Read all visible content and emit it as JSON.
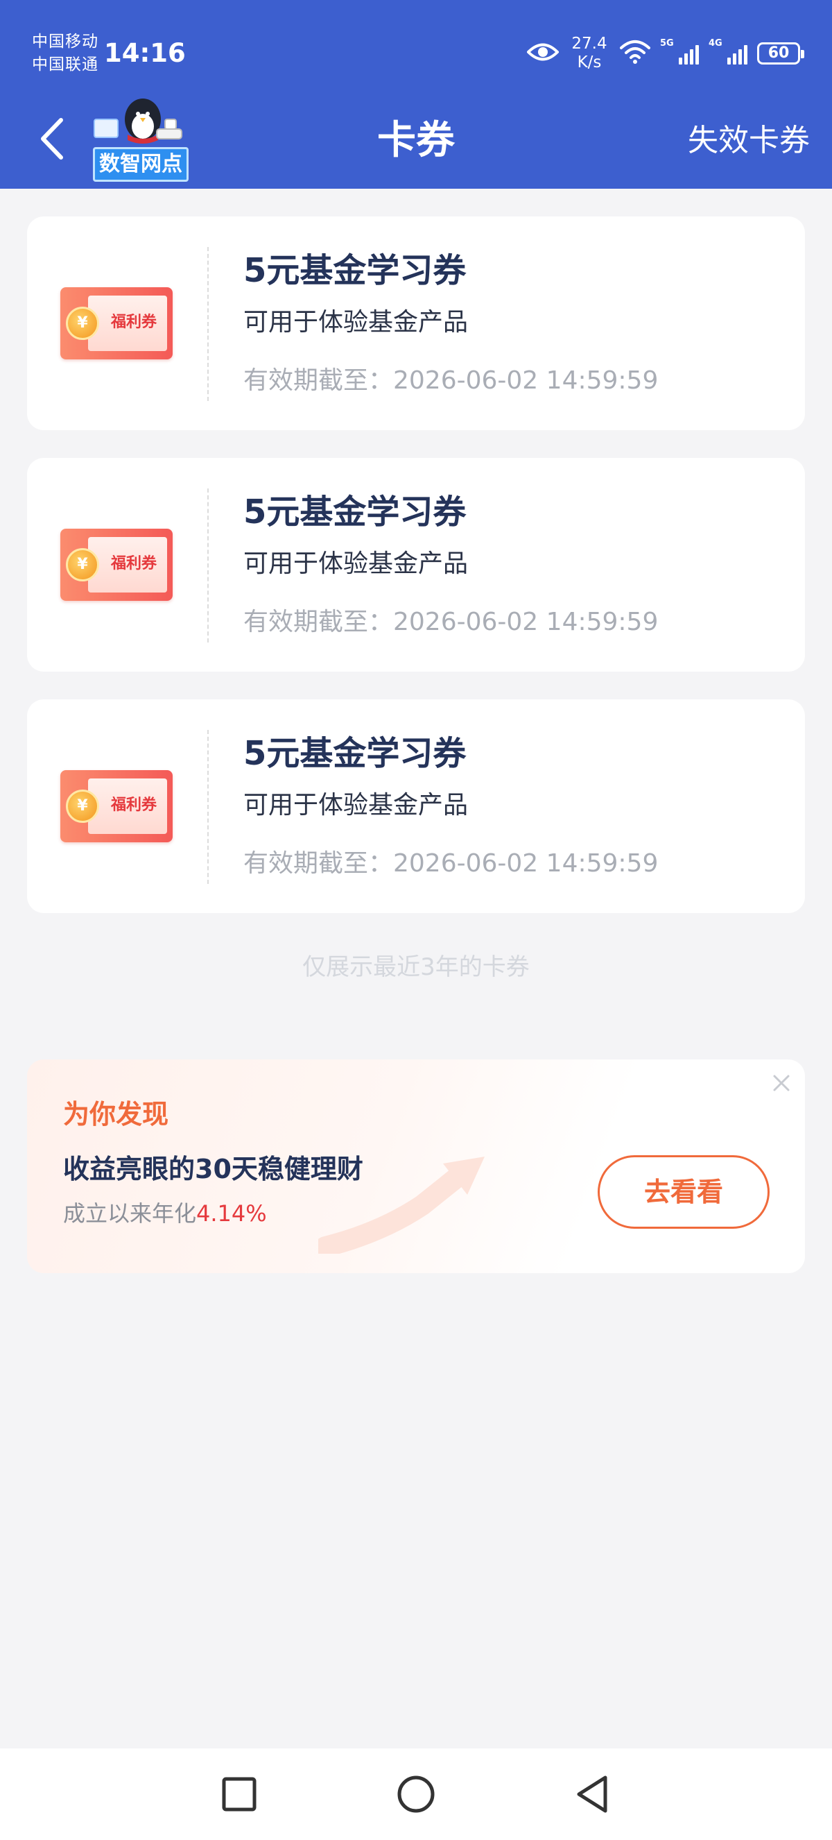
{
  "status_bar": {
    "carrier_1": "中国移动",
    "carrier_2": "中国联通",
    "time": "14:16",
    "net_speed_value": "27.4",
    "net_speed_unit": "K/s",
    "sim1_label": "5G",
    "sim2_label": "4G",
    "battery": "60",
    "icons": [
      "eye-icon",
      "wifi-icon",
      "signal-icon",
      "battery-icon"
    ]
  },
  "header": {
    "back_icon": "chevron-left-icon",
    "logo_text": "数智网点",
    "title": "卡券",
    "right_action": "失效卡券"
  },
  "coupons": [
    {
      "badge": "福利券",
      "title": "5元基金学习券",
      "description": "可用于体验基金产品",
      "expiry": "有效期截至：2026-06-02 14:59:59"
    },
    {
      "badge": "福利券",
      "title": "5元基金学习券",
      "description": "可用于体验基金产品",
      "expiry": "有效期截至：2026-06-02 14:59:59"
    },
    {
      "badge": "福利券",
      "title": "5元基金学习券",
      "description": "可用于体验基金产品",
      "expiry": "有效期截至：2026-06-02 14:59:59"
    }
  ],
  "footnote": "仅展示最近3年的卡券",
  "recommendation": {
    "tag": "为你发现",
    "headline": "收益亮眼的30天稳健理财",
    "sub_prefix": "成立以来年化",
    "rate": "4.14%",
    "button": "去看看",
    "close_icon": "close-icon"
  },
  "system_nav": {
    "icons": [
      "square-recents-icon",
      "circle-home-icon",
      "triangle-back-icon"
    ]
  },
  "colors": {
    "header_bg": "#3d5fcf",
    "page_bg": "#f4f4f6",
    "accent_orange": "#f06a3b",
    "accent_red": "#e5393d",
    "title_navy": "#24335a"
  }
}
